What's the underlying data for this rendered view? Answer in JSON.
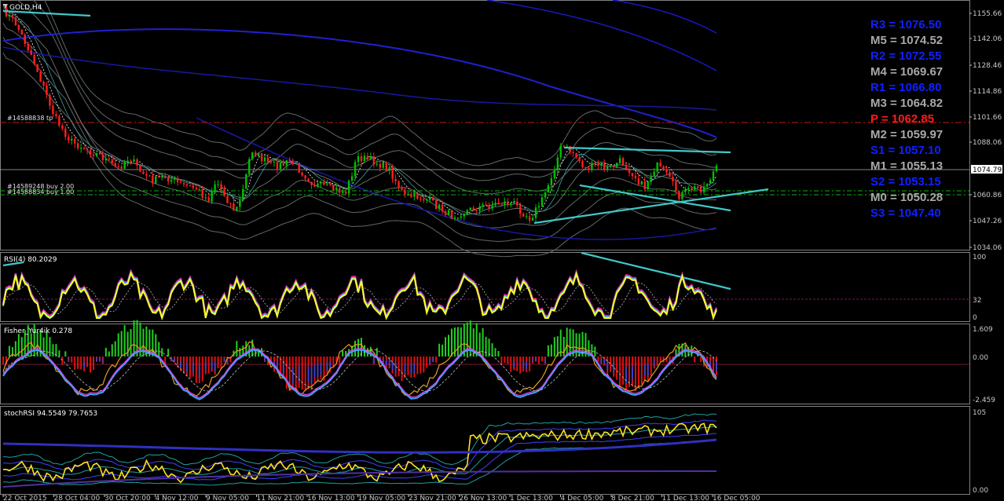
{
  "window": {
    "title": "GOLD,H4"
  },
  "colors": {
    "candle_up": "#00c000",
    "candle_down": "#ff2020",
    "ma_blue": "#2020d0",
    "band_grey": "#606868",
    "trend_cyan": "#40c8c8",
    "pivot_blue": "#1020ff",
    "pivot_grey": "#a8a8a8",
    "pivot_red": "#ff1a1a"
  },
  "pivots": [
    {
      "label": "R3 = 1076.50",
      "color": "blue"
    },
    {
      "label": "M5 = 1074.52",
      "color": "grey"
    },
    {
      "label": "R2 = 1072.55",
      "color": "blue"
    },
    {
      "label": "M4 = 1069.67",
      "color": "grey"
    },
    {
      "label": "R1 = 1066.80",
      "color": "blue"
    },
    {
      "label": "M3 = 1064.82",
      "color": "grey"
    },
    {
      "label": "P  = 1062.85",
      "color": "red"
    },
    {
      "label": "M2 = 1059.97",
      "color": "grey"
    },
    {
      "label": "S1 = 1057.10",
      "color": "blue"
    },
    {
      "label": "M1 = 1055.13",
      "color": "grey"
    },
    {
      "label": "S2 = 1053.15",
      "color": "blue"
    },
    {
      "label": "M0 = 1050.28",
      "color": "grey"
    },
    {
      "label": "S3 = 1047.40",
      "color": "blue"
    }
  ],
  "price_axis": [
    "1155.66",
    "1142.06",
    "1128.46",
    "1114.86",
    "1101.66",
    "1088.06",
    "1074.79",
    "1060.86",
    "1047.26",
    "1034.06"
  ],
  "current_price": "1074.79",
  "order_labels": {
    "tp": "#14588838 tp",
    "buy1": "#14589248 buy 2.00",
    "buy2": "#14588834 buy 1.00"
  },
  "rsi": {
    "label": "RSI(4) 80.2029",
    "axis": [
      "100",
      "32",
      "0"
    ]
  },
  "fisher": {
    "label": "Fisher_Yur4ik 0.278",
    "axis": [
      "1.609",
      "0.00",
      "-2.459"
    ]
  },
  "stochrsi": {
    "label": "stochRSI 94.5549 79.7653",
    "axis": [
      "105",
      "0.00"
    ]
  },
  "time_axis": [
    "22 Oct 2015",
    "28 Oct 04:00",
    "30 Oct 20:00",
    "4 Nov 12:00",
    "9 Nov 05:00",
    "11 Nov 21:00",
    "16 Nov 13:00",
    "19 Nov 05:00",
    "23 Nov 21:00",
    "26 Nov 13:00",
    "1 Dec 13:00",
    "4 Dec 05:00",
    "8 Dec 21:00",
    "11 Dec 13:00",
    "16 Dec 05:00"
  ]
}
